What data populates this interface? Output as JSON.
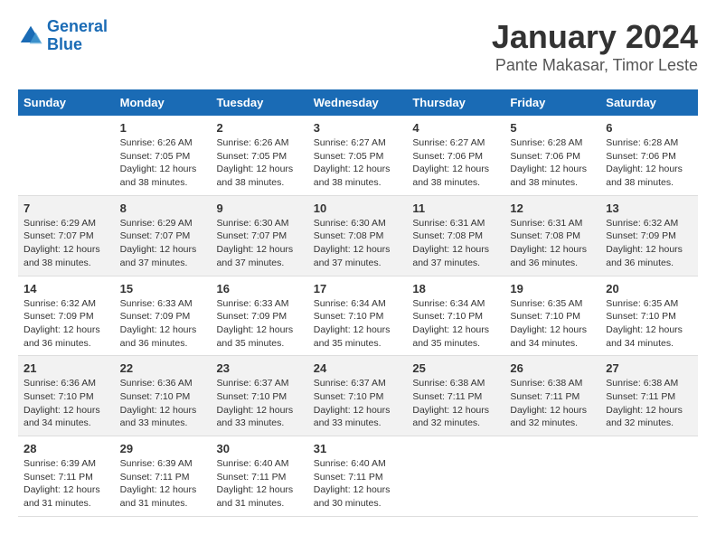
{
  "header": {
    "logo_line1": "General",
    "logo_line2": "Blue",
    "main_title": "January 2024",
    "subtitle": "Pante Makasar, Timor Leste"
  },
  "days_of_week": [
    "Sunday",
    "Monday",
    "Tuesday",
    "Wednesday",
    "Thursday",
    "Friday",
    "Saturday"
  ],
  "weeks": [
    [
      {
        "day": "",
        "text": ""
      },
      {
        "day": "1",
        "text": "Sunrise: 6:26 AM\nSunset: 7:05 PM\nDaylight: 12 hours and 38 minutes."
      },
      {
        "day": "2",
        "text": "Sunrise: 6:26 AM\nSunset: 7:05 PM\nDaylight: 12 hours and 38 minutes."
      },
      {
        "day": "3",
        "text": "Sunrise: 6:27 AM\nSunset: 7:05 PM\nDaylight: 12 hours and 38 minutes."
      },
      {
        "day": "4",
        "text": "Sunrise: 6:27 AM\nSunset: 7:06 PM\nDaylight: 12 hours and 38 minutes."
      },
      {
        "day": "5",
        "text": "Sunrise: 6:28 AM\nSunset: 7:06 PM\nDaylight: 12 hours and 38 minutes."
      },
      {
        "day": "6",
        "text": "Sunrise: 6:28 AM\nSunset: 7:06 PM\nDaylight: 12 hours and 38 minutes."
      }
    ],
    [
      {
        "day": "7",
        "text": "Sunrise: 6:29 AM\nSunset: 7:07 PM\nDaylight: 12 hours and 38 minutes."
      },
      {
        "day": "8",
        "text": "Sunrise: 6:29 AM\nSunset: 7:07 PM\nDaylight: 12 hours and 37 minutes."
      },
      {
        "day": "9",
        "text": "Sunrise: 6:30 AM\nSunset: 7:07 PM\nDaylight: 12 hours and 37 minutes."
      },
      {
        "day": "10",
        "text": "Sunrise: 6:30 AM\nSunset: 7:08 PM\nDaylight: 12 hours and 37 minutes."
      },
      {
        "day": "11",
        "text": "Sunrise: 6:31 AM\nSunset: 7:08 PM\nDaylight: 12 hours and 37 minutes."
      },
      {
        "day": "12",
        "text": "Sunrise: 6:31 AM\nSunset: 7:08 PM\nDaylight: 12 hours and 36 minutes."
      },
      {
        "day": "13",
        "text": "Sunrise: 6:32 AM\nSunset: 7:09 PM\nDaylight: 12 hours and 36 minutes."
      }
    ],
    [
      {
        "day": "14",
        "text": "Sunrise: 6:32 AM\nSunset: 7:09 PM\nDaylight: 12 hours and 36 minutes."
      },
      {
        "day": "15",
        "text": "Sunrise: 6:33 AM\nSunset: 7:09 PM\nDaylight: 12 hours and 36 minutes."
      },
      {
        "day": "16",
        "text": "Sunrise: 6:33 AM\nSunset: 7:09 PM\nDaylight: 12 hours and 35 minutes."
      },
      {
        "day": "17",
        "text": "Sunrise: 6:34 AM\nSunset: 7:10 PM\nDaylight: 12 hours and 35 minutes."
      },
      {
        "day": "18",
        "text": "Sunrise: 6:34 AM\nSunset: 7:10 PM\nDaylight: 12 hours and 35 minutes."
      },
      {
        "day": "19",
        "text": "Sunrise: 6:35 AM\nSunset: 7:10 PM\nDaylight: 12 hours and 34 minutes."
      },
      {
        "day": "20",
        "text": "Sunrise: 6:35 AM\nSunset: 7:10 PM\nDaylight: 12 hours and 34 minutes."
      }
    ],
    [
      {
        "day": "21",
        "text": "Sunrise: 6:36 AM\nSunset: 7:10 PM\nDaylight: 12 hours and 34 minutes."
      },
      {
        "day": "22",
        "text": "Sunrise: 6:36 AM\nSunset: 7:10 PM\nDaylight: 12 hours and 33 minutes."
      },
      {
        "day": "23",
        "text": "Sunrise: 6:37 AM\nSunset: 7:10 PM\nDaylight: 12 hours and 33 minutes."
      },
      {
        "day": "24",
        "text": "Sunrise: 6:37 AM\nSunset: 7:10 PM\nDaylight: 12 hours and 33 minutes."
      },
      {
        "day": "25",
        "text": "Sunrise: 6:38 AM\nSunset: 7:11 PM\nDaylight: 12 hours and 32 minutes."
      },
      {
        "day": "26",
        "text": "Sunrise: 6:38 AM\nSunset: 7:11 PM\nDaylight: 12 hours and 32 minutes."
      },
      {
        "day": "27",
        "text": "Sunrise: 6:38 AM\nSunset: 7:11 PM\nDaylight: 12 hours and 32 minutes."
      }
    ],
    [
      {
        "day": "28",
        "text": "Sunrise: 6:39 AM\nSunset: 7:11 PM\nDaylight: 12 hours and 31 minutes."
      },
      {
        "day": "29",
        "text": "Sunrise: 6:39 AM\nSunset: 7:11 PM\nDaylight: 12 hours and 31 minutes."
      },
      {
        "day": "30",
        "text": "Sunrise: 6:40 AM\nSunset: 7:11 PM\nDaylight: 12 hours and 31 minutes."
      },
      {
        "day": "31",
        "text": "Sunrise: 6:40 AM\nSunset: 7:11 PM\nDaylight: 12 hours and 30 minutes."
      },
      {
        "day": "",
        "text": ""
      },
      {
        "day": "",
        "text": ""
      },
      {
        "day": "",
        "text": ""
      }
    ]
  ]
}
